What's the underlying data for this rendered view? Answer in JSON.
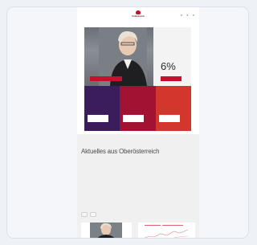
{
  "colors": {
    "page_bg": "#eef1f6",
    "brand_red": "#c8102e",
    "tile_purple": "#3b1d5e",
    "tile_crimson": "#a11233",
    "tile_red": "#d2362c"
  },
  "header": {
    "logo_text": "Volksbank",
    "logo_icon": "bank-logo-icon",
    "icons": [
      "search-icon",
      "user-icon",
      "menu-icon"
    ]
  },
  "breadcrumb": "",
  "hero": {
    "caption": "",
    "button_label": ""
  },
  "rate_panel": {
    "text": "",
    "rate": "6%",
    "button_label": ""
  },
  "tiles": [
    {
      "title": "",
      "body": "",
      "button": ""
    },
    {
      "title": "",
      "body": "",
      "button": ""
    },
    {
      "title": "",
      "body": "",
      "button": ""
    }
  ],
  "news": {
    "title": "Aktuelles aus Oberösterreich",
    "tabs": [
      "",
      ""
    ]
  }
}
